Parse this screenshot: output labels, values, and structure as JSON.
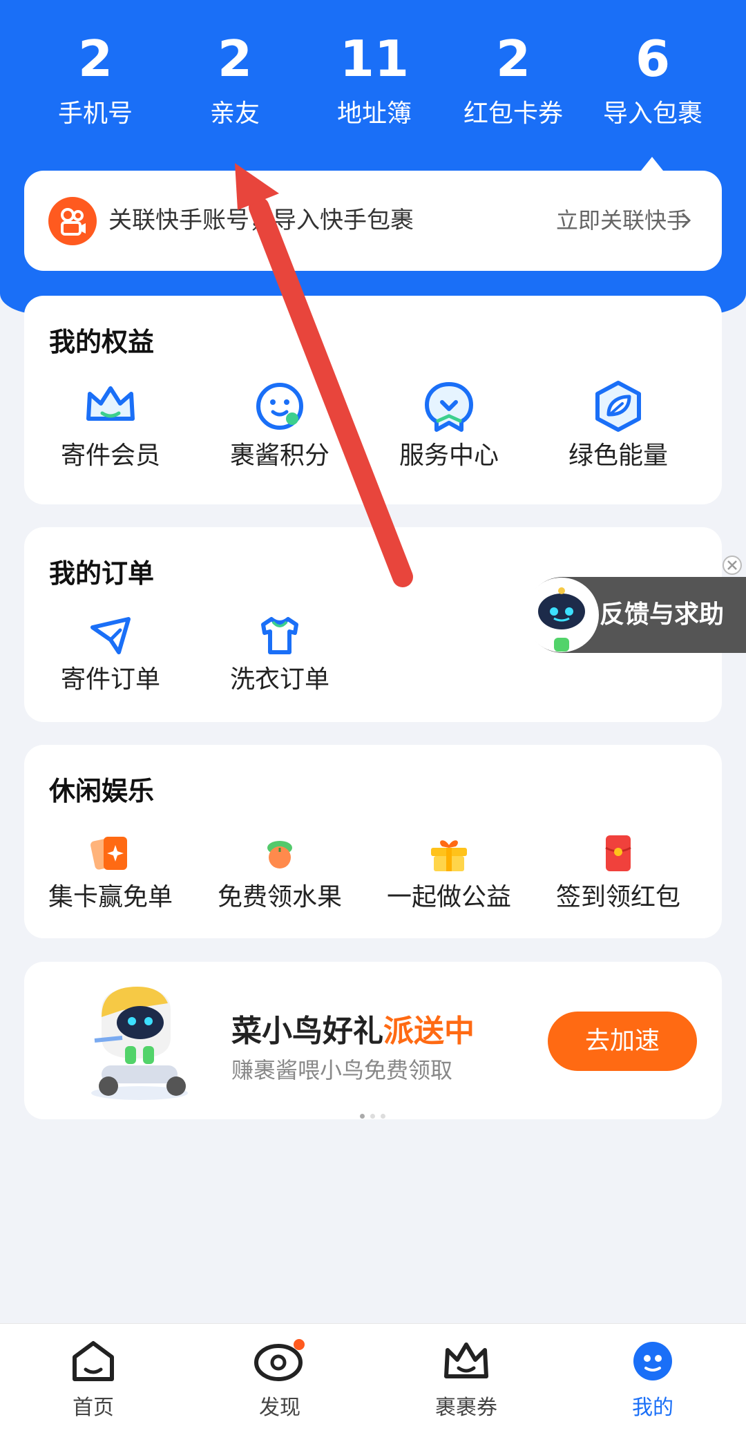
{
  "stats": [
    {
      "value": "2",
      "label": "手机号"
    },
    {
      "value": "2",
      "label": "亲友"
    },
    {
      "value": "11",
      "label": "地址簿"
    },
    {
      "value": "2",
      "label": "红包卡券"
    },
    {
      "value": "6",
      "label": "导入包裹"
    }
  ],
  "link_card": {
    "text": "关联快手账号，导入快手包裹",
    "action": "立即关联快手"
  },
  "benefits": {
    "title": "我的权益",
    "items": [
      "寄件会员",
      "裹酱积分",
      "服务中心",
      "绿色能量"
    ]
  },
  "orders": {
    "title": "我的订单",
    "items": [
      "寄件订单",
      "洗衣订单"
    ]
  },
  "leisure": {
    "title": "休闲娱乐",
    "items": [
      "集卡赢免单",
      "免费领水果",
      "一起做公益",
      "签到领红包"
    ]
  },
  "banner": {
    "title_main": "菜小鸟好礼",
    "title_highlight": "派送中",
    "subtitle": "赚裹酱喂小鸟免费领取",
    "button": "去加速"
  },
  "feedback": {
    "label": "反馈与求助"
  },
  "tabbar": {
    "items": [
      "首页",
      "发现",
      "裹裹券",
      "我的"
    ],
    "active": "我的"
  },
  "colors": {
    "primary": "#1a6ff7",
    "accent": "#ff6a13",
    "annotation_arrow": "#e8453c"
  },
  "icons": {
    "benefits": [
      "crown-icon",
      "smile-face-icon",
      "service-heart-icon",
      "leaf-hexagon-icon"
    ],
    "orders": [
      "paper-plane-icon",
      "tshirt-icon"
    ],
    "leisure": [
      "card-icon",
      "fruit-icon",
      "gift-icon",
      "red-envelope-icon"
    ],
    "tabbar": [
      "home-icon",
      "eye-icon",
      "crown-icon",
      "bird-avatar-icon"
    ]
  }
}
